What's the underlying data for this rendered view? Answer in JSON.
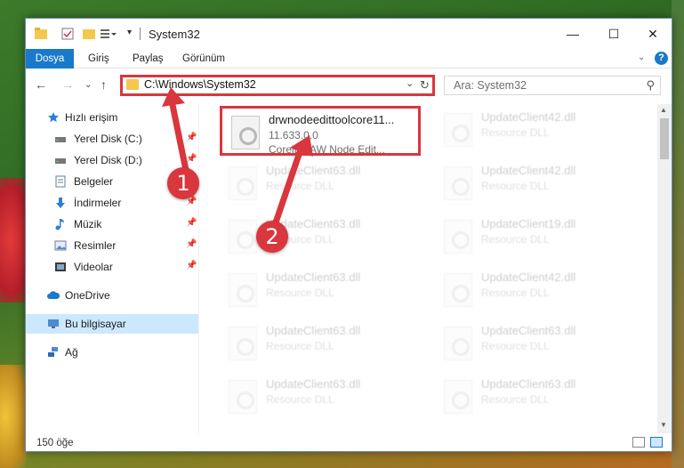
{
  "window": {
    "title": "System32",
    "controls": {
      "minimize": "—",
      "maximize": "☐",
      "close": "✕"
    }
  },
  "ribbon": {
    "tabs": [
      {
        "label": "Dosya",
        "active": true
      },
      {
        "label": "Giriş"
      },
      {
        "label": "Paylaş"
      },
      {
        "label": "Görünüm"
      }
    ],
    "help": "?"
  },
  "nav": {
    "address": "C:\\Windows\\System32",
    "search_placeholder": "Ara: System32"
  },
  "sidebar": {
    "items": [
      {
        "label": "Hızlı erişim",
        "icon": "star-icon",
        "pinned": false
      },
      {
        "label": "Yerel Disk (C:)",
        "icon": "drive-icon",
        "pinned": true
      },
      {
        "label": "Yerel Disk (D:)",
        "icon": "drive-icon",
        "pinned": true
      },
      {
        "label": "Belgeler",
        "icon": "document-icon",
        "pinned": true
      },
      {
        "label": "İndirmeler",
        "icon": "download-icon",
        "pinned": true
      },
      {
        "label": "Müzik",
        "icon": "music-icon",
        "pinned": true
      },
      {
        "label": "Resimler",
        "icon": "picture-icon",
        "pinned": true
      },
      {
        "label": "Videolar",
        "icon": "video-icon",
        "pinned": true
      },
      {
        "label": "OneDrive",
        "icon": "cloud-icon",
        "pinned": false
      },
      {
        "label": "Bu bilgisayar",
        "icon": "computer-icon",
        "pinned": false,
        "selected": true
      },
      {
        "label": "Ağ",
        "icon": "network-icon",
        "pinned": false
      }
    ]
  },
  "files": {
    "highlighted": {
      "name": "drwnodeedittoolcore11...",
      "version": "11.633.0.0",
      "description": "CorelDRAW Node Edit..."
    },
    "left_column": [
      {
        "name": "UpdateClient63.dll",
        "type": "Resource DLL"
      },
      {
        "name": "UpdateClient63.dll",
        "type": "Resource DLL"
      },
      {
        "name": "UpdateClient63.dll",
        "type": "Resource DLL"
      },
      {
        "name": "UpdateClient63.dll",
        "type": "Resource DLL"
      },
      {
        "name": "UpdateClient63.dll",
        "type": "Resource DLL"
      }
    ],
    "right_column": [
      {
        "name": "UpdateClient42.dll",
        "type": "Resource DLL"
      },
      {
        "name": "UpdateClient42.dll",
        "type": "Resource DLL"
      },
      {
        "name": "UpdateClient19.dll",
        "type": "Resource DLL"
      },
      {
        "name": "UpdateClient42.dll",
        "type": "Resource DLL"
      },
      {
        "name": "UpdateClient63.dll",
        "type": "Resource DLL"
      },
      {
        "name": "UpdateClient63.dll",
        "type": "Resource DLL"
      }
    ]
  },
  "status": {
    "item_count": "150 öğe"
  },
  "callouts": [
    "1",
    "2"
  ],
  "colors": {
    "accent": "#1979ca",
    "highlight": "#d9363e",
    "selected": "#cce8ff"
  }
}
